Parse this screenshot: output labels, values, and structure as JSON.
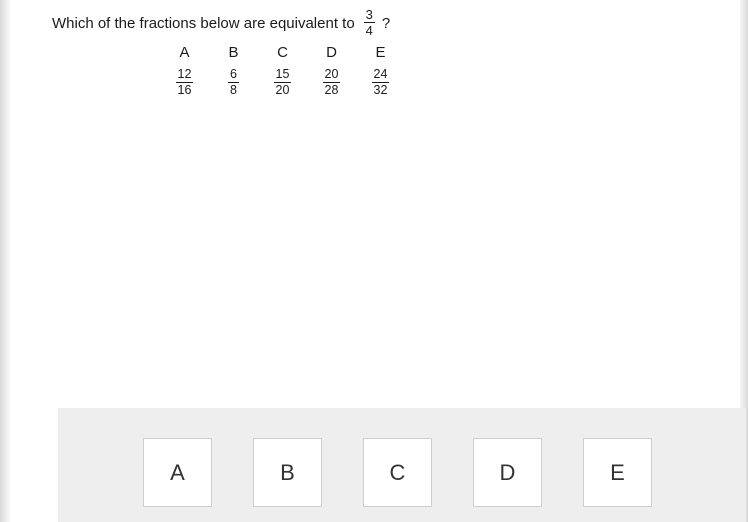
{
  "question": {
    "text": "Which of the fractions below are equivalent to",
    "fraction": {
      "numerator": "3",
      "denominator": "4"
    },
    "question_mark": "?"
  },
  "options": [
    {
      "letter": "A",
      "numerator": "12",
      "denominator": "16"
    },
    {
      "letter": "B",
      "numerator": "6",
      "denominator": "8"
    },
    {
      "letter": "C",
      "numerator": "15",
      "denominator": "20"
    },
    {
      "letter": "D",
      "numerator": "20",
      "denominator": "28"
    },
    {
      "letter": "E",
      "numerator": "24",
      "denominator": "32"
    }
  ],
  "answer_bar": {
    "buttons": [
      {
        "label": "A"
      },
      {
        "label": "B"
      },
      {
        "label": "C"
      },
      {
        "label": "D"
      },
      {
        "label": "E"
      }
    ]
  },
  "colors": {
    "page_background": "#ffffff",
    "answer_bar_background": "#eeeeee",
    "button_background": "#ffffff",
    "button_border": "#cfcfcf",
    "text": "#1b1b1b",
    "button_text": "#333333"
  }
}
